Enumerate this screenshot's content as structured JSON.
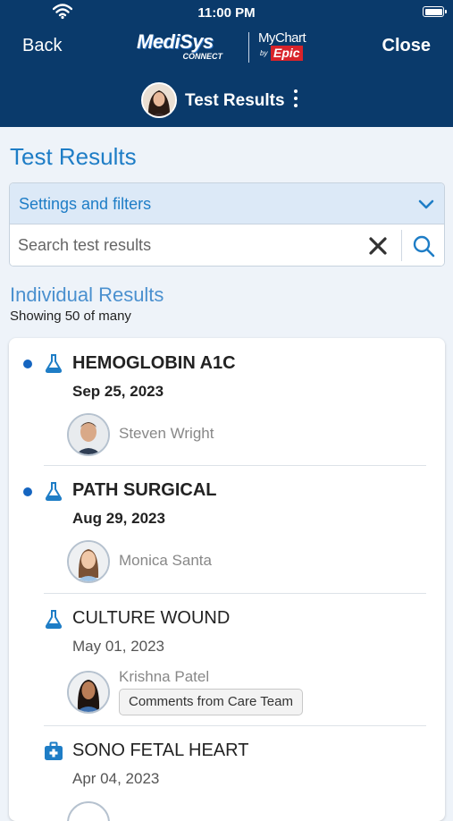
{
  "status_bar": {
    "time": "11:00 PM"
  },
  "nav": {
    "back_label": "Back",
    "close_label": "Close",
    "logo_medisys_text": "MediSys",
    "logo_medisys_sub": "CONNECT",
    "logo_mychart_text": "MyChart",
    "logo_mychart_by": "by",
    "logo_mychart_epic": "Epic",
    "page_label": "Test Results"
  },
  "page": {
    "title": "Test Results",
    "filters_label": "Settings and filters",
    "search_placeholder": "Search test results"
  },
  "section": {
    "title": "Individual Results",
    "subtitle": "Showing 50 of many"
  },
  "results": [
    {
      "name": "HEMOGLOBIN A1C",
      "date": "Sep 25, 2023",
      "provider": "Steven Wright",
      "unread": true,
      "icon": "flask-icon"
    },
    {
      "name": "PATH SURGICAL",
      "date": "Aug 29, 2023",
      "provider": "Monica Santa",
      "unread": true,
      "icon": "flask-icon"
    },
    {
      "name": "CULTURE WOUND",
      "date": "May 01, 2023",
      "provider": "Krishna Patel",
      "unread": false,
      "icon": "flask-icon",
      "comments_label": "Comments from Care Team"
    },
    {
      "name": "SONO FETAL HEART",
      "date": "Apr 04, 2023",
      "provider": "",
      "unread": false,
      "icon": "medical-bag-icon"
    }
  ],
  "colors": {
    "header_bg": "#0a3a6b",
    "accent": "#1e7dc6",
    "unread_dot": "#1565c0",
    "epic_red": "#d8232a"
  }
}
